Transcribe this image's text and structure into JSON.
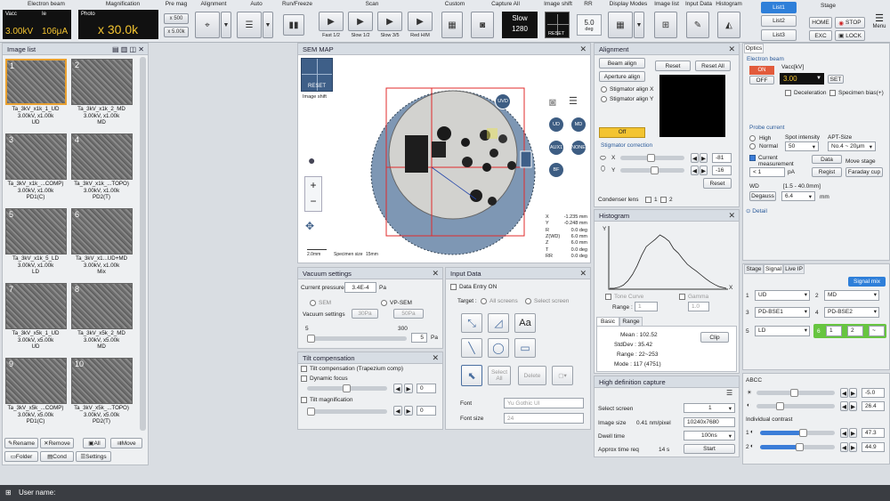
{
  "toolbar": {
    "electron_beam": "Electron beam",
    "vacc_label": "Vacc",
    "vacc_value": "3.00kV",
    "ie_label": "Ie",
    "ie_value": "106μA",
    "magnification": "Magnification",
    "photo_label": "Photo",
    "mag_value": "x 30.0k",
    "pre_mag": "Pre mag",
    "pre_mag_1": "x 500",
    "pre_mag_2": "x 5.00k",
    "alignment": "Alignment",
    "auto": "Auto",
    "run_freeze": "Run/Freeze",
    "scan": "Scan",
    "scan_buttons": [
      "Fast 1/2",
      "Slow 1/2",
      "Slow 3/5",
      "Red H/M"
    ],
    "custom": "Custom",
    "capture_all": "Capture All",
    "slow": "Slow",
    "slow_value": "1280",
    "image_shift": "Image shift",
    "reset": "RESET",
    "rr": "RR",
    "rr_value": "5.0",
    "rr_unit": "deg",
    "display_modes": "Display Modes",
    "image_list": "Image list",
    "input_data": "Input Data",
    "histogram": "Histogram",
    "list1": "List1",
    "list2": "List2",
    "list3": "List3",
    "stage": "Stage",
    "home": "HOME",
    "stop": "STOP",
    "menu": "Menu",
    "exc": "EXC",
    "lock": "LOCK"
  },
  "image_list": {
    "title": "Image list",
    "items": [
      {
        "num": "1",
        "name": "Ta_3kV_x1k_1_UD",
        "info": "3.00kV, x1.00k",
        "det": "UD"
      },
      {
        "num": "2",
        "name": "Ta_3kV_x1k_2_MD",
        "info": "3.00kV, x1.00k",
        "det": "MD"
      },
      {
        "num": "3",
        "name": "Ta_3kV_x1k_...COMP)",
        "info": "3.00kV, x1.00k",
        "det": "PD1(C)"
      },
      {
        "num": "4",
        "name": "Ta_3kV_x1k_...TOPO)",
        "info": "3.00kV, x1.00k",
        "det": "PD2(T)"
      },
      {
        "num": "5",
        "name": "Ta_3kV_x1k_5_LD",
        "info": "3.00kV, x1.00k",
        "det": "LD"
      },
      {
        "num": "6",
        "name": "Ta_3kV_x1...UD+MD",
        "info": "3.00kV, x1.00k",
        "det": "Mix"
      },
      {
        "num": "7",
        "name": "Ta_3kV_x5k_1_UD",
        "info": "3.00kV, x5.00k",
        "det": "UD"
      },
      {
        "num": "8",
        "name": "Ta_3kV_x5k_2_MD",
        "info": "3.00kV, x5.00k",
        "det": "MD"
      },
      {
        "num": "9",
        "name": "Ta_3kV_x5k_...COMP)",
        "info": "3.00kV, x5.00k",
        "det": "PD1(C)"
      },
      {
        "num": "10",
        "name": "Ta_3kV_x5k_...TOPO)",
        "info": "3.00kV, x5.00k",
        "det": "PD2(T)"
      }
    ],
    "buttons": [
      "Rename",
      "Remove",
      "All",
      "Move",
      "Folder",
      "Cond",
      "Settings"
    ]
  },
  "sem_map": {
    "title": "SEM MAP",
    "reset": "RESET",
    "image_shift": "Image shift",
    "buttons": [
      "UVD",
      "UD",
      "MD",
      "AUX1",
      "NONE",
      "BF"
    ],
    "coords": [
      {
        "k": "X",
        "v": "-1.235 mm"
      },
      {
        "k": "Y",
        "v": "-0.248 mm"
      },
      {
        "k": "R",
        "v": "0.0 deg"
      },
      {
        "k": "Z(WD)",
        "v": "6.0 mm"
      },
      {
        "k": "Z",
        "v": "6.0 mm"
      },
      {
        "k": "T",
        "v": "0.0 deg"
      },
      {
        "k": "RR",
        "v": "0.0 deg"
      }
    ],
    "scale": "2.0mm",
    "specimen_size": "Specimen size",
    "specimen_value": "15mm"
  },
  "alignment": {
    "title": "Alignment",
    "beam_align": "Beam align",
    "aperture_align": "Aperture align",
    "reset": "Reset",
    "reset_all": "Reset All",
    "stig_x": "Stigmator align X",
    "stig_y": "Stigmator align Y",
    "off": "Off",
    "stig_correction": "Stigmator correction",
    "x_label": "X",
    "x_value": "-81",
    "y_label": "Y",
    "y_value": "-16",
    "reset2": "Reset",
    "condenser": "Condenser lens",
    "cond_1": "1",
    "cond_2": "2"
  },
  "histogram": {
    "title": "Histogram",
    "y": "Y",
    "x": "X",
    "tone_curve": "Tone Curve",
    "gamma": "Gamma",
    "range": "Range :",
    "range_val": "1",
    "gamma_val": "1.0",
    "tab_basic": "Basic",
    "tab_range": "Range",
    "mean": "Mean : 102.52",
    "stddev": "StdDev : 35.42",
    "range_stat": "Range : 22~253",
    "mode": "Mode : 117 (4751)",
    "clip": "Clip"
  },
  "vacuum": {
    "title": "Vacuum settings",
    "current_pressure": "Current pressure",
    "pressure_value": "3.4E-4",
    "pa": "Pa",
    "sem": "SEM",
    "vp_sem": "VP-SEM",
    "vacuum_settings": "Vacuum settings",
    "v30": "30Pa",
    "v50": "50Pa",
    "min": "5",
    "max": "300",
    "val": "5",
    "pa2": "Pa"
  },
  "tilt": {
    "title": "Tilt compensation",
    "tilt_comp": "Tilt compensation (Trapezium comp)",
    "dynamic": "Dynamic focus",
    "val1": "0",
    "tilt_mag": "Tilt magnification",
    "val2": "0"
  },
  "input_data": {
    "title": "Input Data",
    "entry_on": "Data Entry ON",
    "target": "Target :",
    "all_screens": "All screens",
    "select_screen": "Select screen",
    "aa": "Aa",
    "select_all": "Select All",
    "delete": "Delete",
    "font": "Font",
    "font_value": "Yu Gothic UI",
    "font_size": "Font size",
    "font_size_value": "24"
  },
  "hd_capture": {
    "title": "High definition capture",
    "select_screen": "Select screen",
    "select_val": "1",
    "image_size": "Image size",
    "pixel": "0.41 nm/pixel",
    "size_val": "10240x7680",
    "dwell": "Dwell time",
    "dwell_val": "100ns",
    "approx": "Approx time req",
    "approx_val": "14 s",
    "start": "Start"
  },
  "optics": {
    "tab": "Optics",
    "electron_beam": "Electron beam",
    "on": "ON",
    "off": "OFF",
    "vacc_label": "Vacc[kV]",
    "vacc_value": "3.00",
    "set": "SET",
    "deceleration": "Deceleration",
    "specimen_bias": "Specimen bias(+)",
    "probe_current": "Probe current",
    "high": "High",
    "normal": "Normal",
    "spot_intensity": "Spot intensity",
    "spot_val": "50",
    "apt_size": "APT-Size",
    "apt_val": "No.4 ~ 20μm",
    "current_meas": "Current measurement",
    "data": "Data",
    "move_stage": "Move stage",
    "lt1": "< 1",
    "pa": "pA",
    "regist": "Regist",
    "faraday": "Faraday cup",
    "wd": "WD",
    "wd_range": "[1.5 - 40.0mm]",
    "degauss": "Degauss",
    "wd_val": "6.4",
    "mm": "mm",
    "detail": "Detail"
  },
  "signal": {
    "tabs": [
      "Stage",
      "Signal",
      "Live IP"
    ],
    "signal_mix": "Signal mix",
    "rows": [
      {
        "n": "1",
        "v": "UD"
      },
      {
        "n": "2",
        "v": "MD"
      },
      {
        "n": "3",
        "v": "PD-BSE1"
      },
      {
        "n": "4",
        "v": "PD-BSE2"
      },
      {
        "n": "5",
        "v": "LD"
      },
      {
        "n": "6",
        "v": "1"
      }
    ],
    "mix_2": "2",
    "mix_op": "~"
  },
  "abcc": {
    "title": "ABCC",
    "v1": "-5.0",
    "v2": "26.4",
    "individual": "Individual contrast",
    "c1": "1",
    "c1_val": "47.3",
    "c2": "2",
    "c2_val": "44.9"
  },
  "status": {
    "user_name": "User name:"
  },
  "chart_data": {
    "type": "line",
    "title": "",
    "xlabel": "X",
    "ylabel": "Y",
    "x": [
      0,
      10,
      20,
      30,
      40,
      50,
      60,
      70,
      80,
      90,
      100,
      110,
      120,
      130,
      140,
      150,
      160,
      170,
      180,
      190,
      200,
      210,
      220,
      230,
      240,
      255
    ],
    "values": [
      0,
      0,
      2,
      6,
      14,
      26,
      42,
      62,
      78,
      85,
      92,
      100,
      95,
      88,
      74,
      66,
      55,
      45,
      38,
      32,
      25,
      18,
      12,
      7,
      3,
      0
    ],
    "xlim": [
      0,
      255
    ],
    "ylim": [
      0,
      110
    ]
  }
}
